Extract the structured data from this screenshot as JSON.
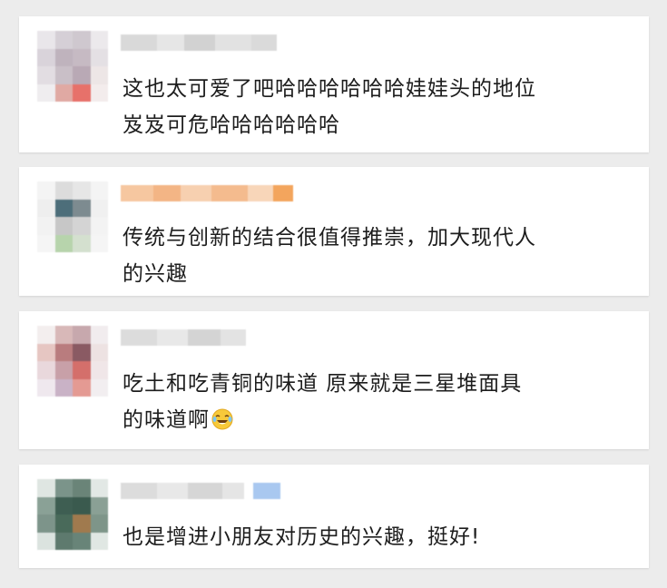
{
  "comments": [
    {
      "text_line1": "这也太可爱了吧哈哈哈哈哈哈娃娃头的地位",
      "text_line2": "岌岌可危哈哈哈哈哈哈"
    },
    {
      "text_line1": "传统与创新的结合很值得推崇，加大现代人",
      "text_line2": "的兴趣"
    },
    {
      "text_line1": "吃土和吃青铜的味道 原来就是三星堆面具",
      "text_line2": "的味道啊",
      "emoji": "laughing-tears-icon"
    },
    {
      "text_line1": "也是增进小朋友对历史的兴趣，挺好!"
    }
  ],
  "colors": {
    "page_bg": "#ececec",
    "card_bg": "#ffffff",
    "text": "#1d1d1d",
    "nickname_blur": "#d8d8d8",
    "nickname_orange": "#f5b27a",
    "nickname_blue": "#a9c8f0"
  }
}
